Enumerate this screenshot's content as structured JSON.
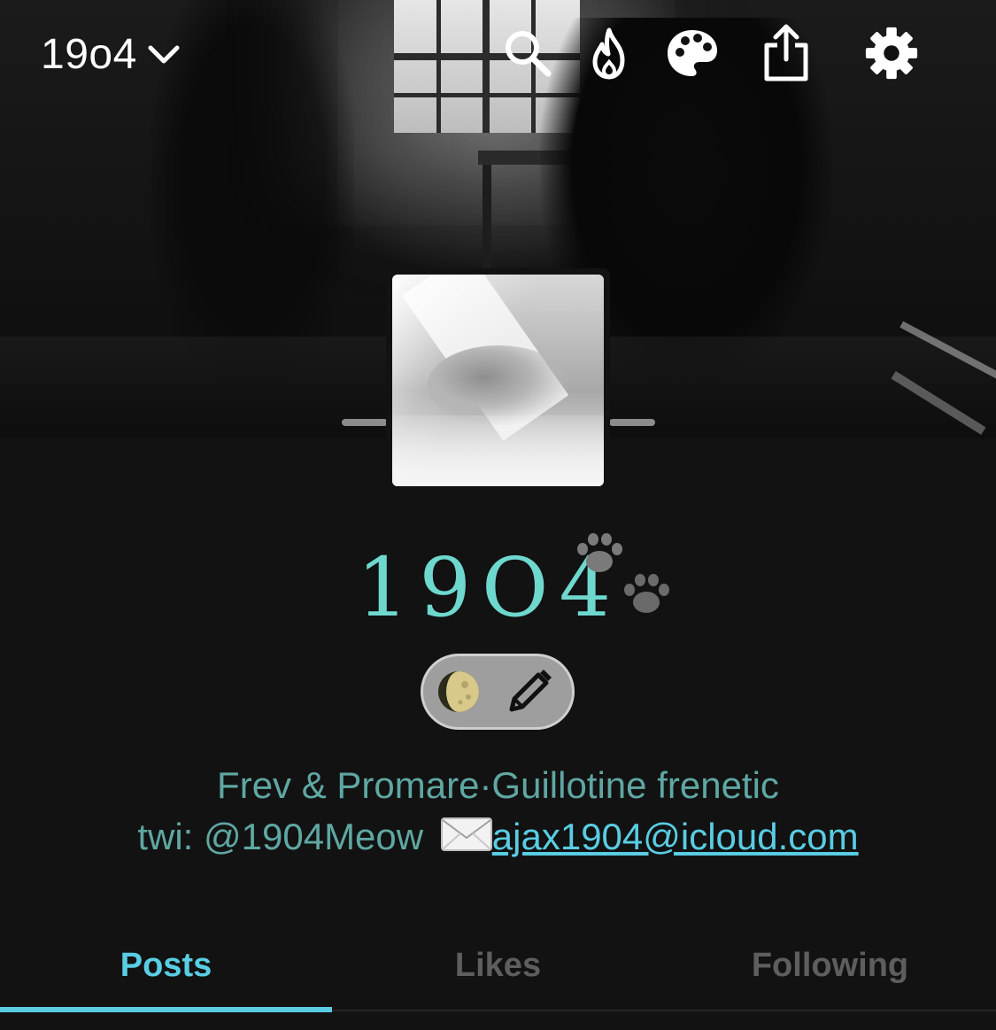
{
  "header": {
    "blog_name": "19o4",
    "icons": [
      "chevron-down-icon",
      "search-icon",
      "flame-icon",
      "palette-icon",
      "share-icon",
      "gear-icon"
    ]
  },
  "profile": {
    "title": "19O4",
    "pill_icons": [
      "moon-icon",
      "pencil-icon"
    ],
    "description_line1": "Frev & Promare·Guillotine frenetic",
    "description_line2_prefix": "twi: @1904Meow",
    "email": "ajax1904@icloud.com"
  },
  "tabs": [
    {
      "label": "Posts",
      "active": true
    },
    {
      "label": "Likes",
      "active": false
    },
    {
      "label": "Following",
      "active": false
    }
  ],
  "colors": {
    "accent": "#59cde3",
    "title": "#6ed8cf",
    "description": "#5fa7a2",
    "background": "#121212"
  }
}
